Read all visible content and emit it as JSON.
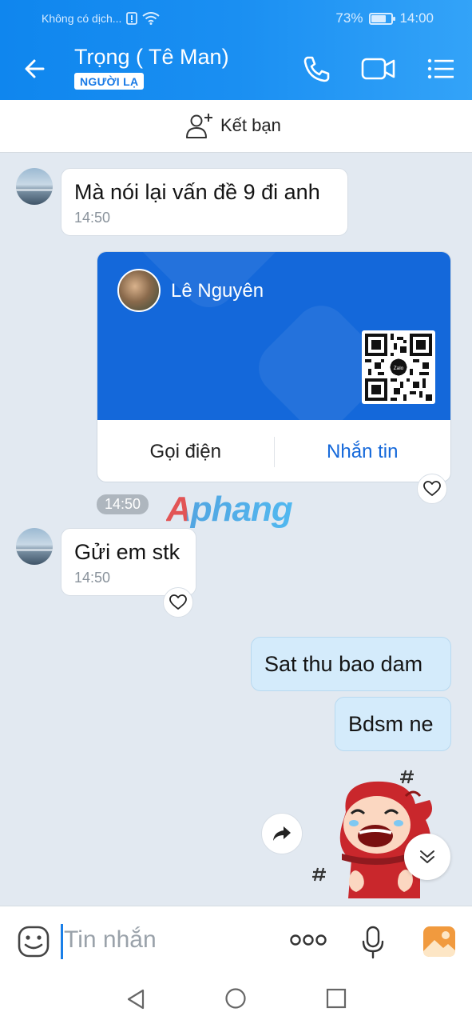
{
  "status_bar": {
    "carrier": "Không có dịch...",
    "battery": "73%",
    "battery_level": 0.73,
    "time": "14:00"
  },
  "header": {
    "title": "Trọng ( Tê Man)",
    "badge": "NGƯỜI LẠ"
  },
  "friend_bar": {
    "label": "Kết bạn"
  },
  "messages": [
    {
      "text": "Mà nói lại vấn đề 9 đi anh",
      "time": "14:50"
    },
    {
      "text": "Gửi em stk",
      "time": "14:50"
    },
    {
      "text": "Sat thu bao dam"
    },
    {
      "text": "Bdsm ne"
    }
  ],
  "contact_card": {
    "name": "Lê Nguyên",
    "qr_label": "Zalo",
    "call_label": "Gọi điện",
    "message_label": "Nhắn tin"
  },
  "card_time": "14:50",
  "watermark": "Aphang",
  "input": {
    "placeholder": "Tin nhắn"
  },
  "colors": {
    "primary": "#1468da",
    "accent": "#1a7fe8",
    "own_bubble": "#d4ebfb"
  },
  "icons": [
    "back-arrow-icon",
    "phone-icon",
    "video-call-icon",
    "menu-list-icon",
    "add-friend-icon",
    "heart-icon",
    "share-forward-icon",
    "scroll-down-icon",
    "emoji-icon",
    "more-icon",
    "microphone-icon",
    "image-icon",
    "nav-back-icon",
    "nav-home-icon",
    "nav-recents-icon"
  ]
}
